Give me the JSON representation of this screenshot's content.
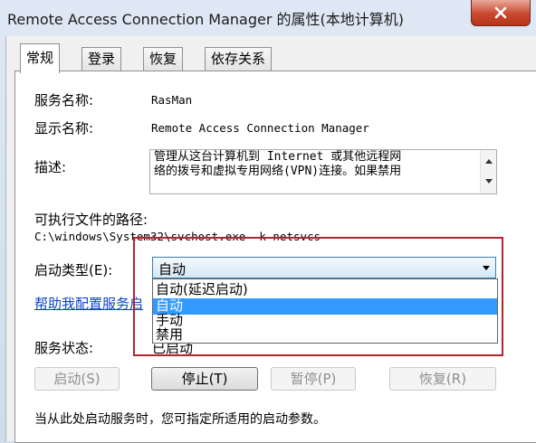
{
  "window": {
    "title": "Remote Access Connection Manager 的属性(本地计算机)"
  },
  "tabs": [
    {
      "label": "常规"
    },
    {
      "label": "登录"
    },
    {
      "label": "恢复"
    },
    {
      "label": "依存关系"
    }
  ],
  "general": {
    "service_name_label": "服务名称:",
    "service_name_value": "RasMan",
    "display_name_label": "显示名称:",
    "display_name_value": "Remote Access Connection Manager",
    "description_label": "描述:",
    "description_line1": "管理从这台计算机到 Internet 或其他远程网",
    "description_line2": "络的拨号和虚拟专用网络(VPN)连接。如果禁用",
    "exe_path_label": "可执行文件的路径:",
    "exe_path_value": "C:\\windows\\System32\\svchost.exe -k netsvcs",
    "startup_type_label": "启动类型(E):",
    "startup_type_value": "自动",
    "startup_options": [
      "自动(延迟启动)",
      "自动",
      "手动",
      "禁用"
    ],
    "help_link": "帮助我配置服务启",
    "status_label": "服务状态:",
    "status_value": "已启动",
    "start_button": "启动(S)",
    "stop_button": "停止(T)",
    "pause_button": "暂停(P)",
    "resume_button": "恢复(R)",
    "footnote": "当从此处启动服务时，您可指定所适用的启动参数。"
  },
  "colors": {
    "selection": "#3399ff",
    "highlight_box": "#b3242f",
    "link": "#0a45c7"
  }
}
